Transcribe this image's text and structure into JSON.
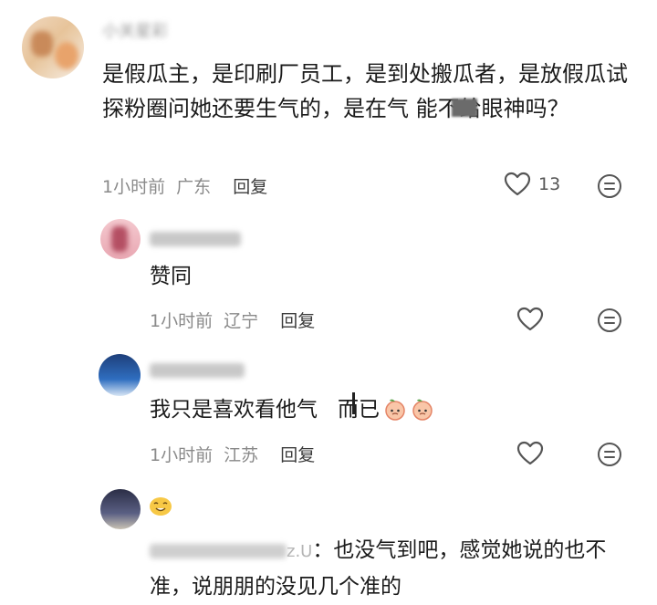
{
  "main_comment": {
    "username": "小关星彩",
    "text": "是假瓜主，是印刷厂员工，是到处搬瓜者，是放假瓜试探粉圈问她还要生气的，是在气      能不给眼神吗？",
    "time": "1小时前",
    "location": "广东",
    "reply_label": "回复",
    "like_count": "13"
  },
  "replies": [
    {
      "username": "",
      "text": "赞同",
      "time": "1小时前",
      "location": "辽宁",
      "reply_label": "回复"
    },
    {
      "username": "",
      "text_a": "我只是喜欢看他气",
      "text_b": "而已",
      "time": "1小时前",
      "location": "江苏",
      "reply_label": "回复"
    },
    {
      "emoji": "smiling-emoji",
      "username_suffix": "z.U",
      "text": "：也没气到吧，感觉她说的也不准，说朋朋的没见几个准的"
    }
  ],
  "icons": {
    "heart": "heart-icon",
    "comment": "comment-icon",
    "peach": "peach-emoji-icon"
  },
  "colors": {
    "text": "#1b1b1b",
    "meta": "#8a8a8a",
    "icon_stroke": "#555555"
  }
}
